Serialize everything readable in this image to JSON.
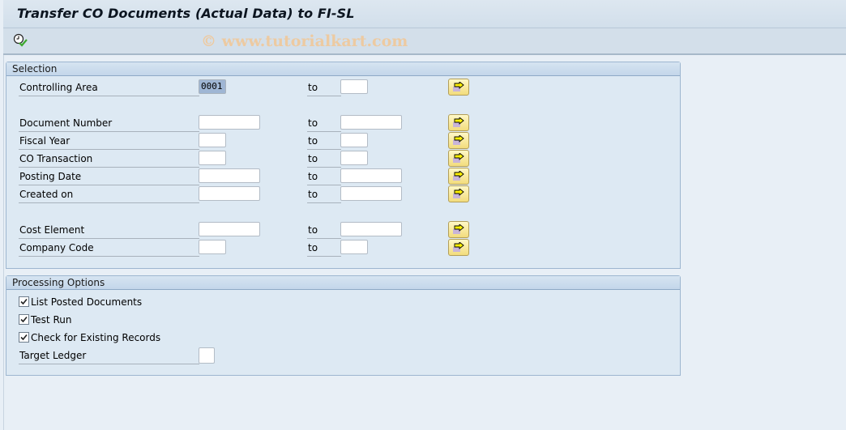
{
  "window": {
    "title": "Transfer CO Documents (Actual Data) to FI-SL",
    "watermark": "© www.tutorialkart.com"
  },
  "toolbar": {
    "execute_icon": "execute-clock-check-icon"
  },
  "selection": {
    "heading": "Selection",
    "to_label": "to",
    "rows": [
      {
        "label": "Controlling Area",
        "from": "0001",
        "to": ""
      },
      {
        "label": "Document Number",
        "from": "",
        "to": ""
      },
      {
        "label": "Fiscal Year",
        "from": "",
        "to": ""
      },
      {
        "label": "CO Transaction",
        "from": "",
        "to": ""
      },
      {
        "label": "Posting Date",
        "from": "",
        "to": ""
      },
      {
        "label": "Created on",
        "from": "",
        "to": ""
      },
      {
        "label": "Cost Element",
        "from": "",
        "to": ""
      },
      {
        "label": "Company Code",
        "from": "",
        "to": ""
      }
    ],
    "multiple_selection_icon": "multiple-selection-arrow-icon"
  },
  "processing": {
    "heading": "Processing Options",
    "options": [
      {
        "label": "List Posted Documents",
        "checked": true
      },
      {
        "label": "Test Run",
        "checked": true
      },
      {
        "label": "Check for Existing Records",
        "checked": true
      }
    ],
    "target_ledger": {
      "label": "Target Ledger",
      "value": ""
    }
  },
  "colors": {
    "background": "#e8eff6",
    "group_body": "#dde9f3",
    "group_border": "#9db6d0",
    "multi_button": "#f2dc7c",
    "watermark": "#f0c89a"
  }
}
